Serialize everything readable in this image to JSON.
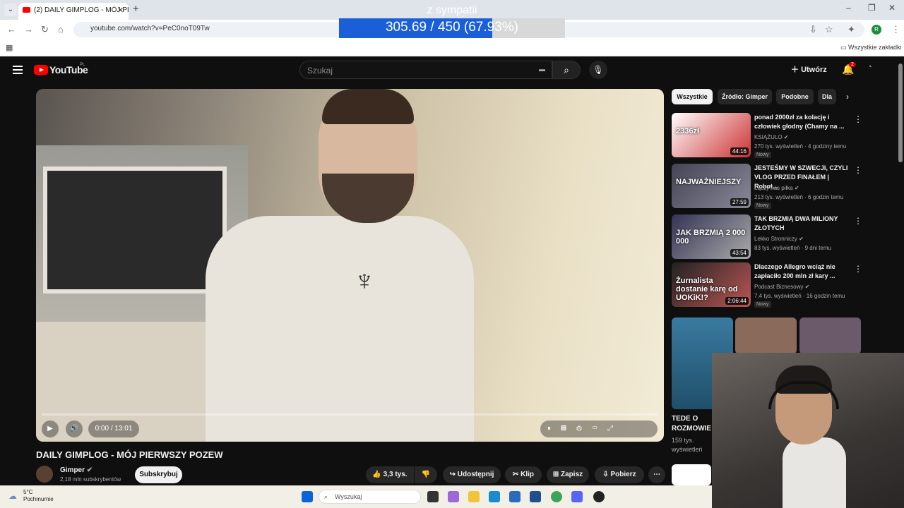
{
  "browser": {
    "tab_title": "(2) DAILY GIMPLOG - MÓJ PIERW...",
    "url": "youtube.com/watch?v=PeC0noT09Tw",
    "bookmarks_label": "Wszystkie zakładki"
  },
  "overlay": {
    "label": "z sympatii",
    "progress_text": "305.69 / 450 (67.93%)",
    "progress": 0.6793
  },
  "yt": {
    "logo": "YouTube",
    "region": "PL",
    "search_placeholder": "Szukaj",
    "create_label": "Utwórz",
    "notif_count": "2"
  },
  "video": {
    "time": "0:00 / 13:01",
    "title": "DAILY GIMPLOG - MÓJ PIERWSZY POZEW",
    "channel": "Gimper",
    "subscribers": "2,18 mln subskrybentów",
    "subscribe_label": "Subskrybuj",
    "likes": "3,3 tys.",
    "share": "Udostępnij",
    "clip": "Klip",
    "save": "Zapisz",
    "download": "Pobierz"
  },
  "chips": [
    "Wszystkie",
    "Źródło: Gimper",
    "Podobne",
    "Dla"
  ],
  "recs": [
    {
      "title": "ponad 2000zł za kolację i człowiek głodny (Chamy na ...",
      "channel": "KSIĄŻULO",
      "meta": "270 tys. wyświetleń · 4 godziny temu",
      "new": "Nowy",
      "duration": "44:16",
      "thumb_text": "2336zł"
    },
    {
      "title": "JESTEŚMY W SZWECJI, CZYLI VLOG PRZED FINAŁEM | Robot...",
      "channel": "Łączy nas piłka",
      "meta": "213 tys. wyświetleń · 6 godzin temu",
      "new": "Nowy",
      "duration": "27:59",
      "thumb_text": "NAJWAŻNIEJSZY"
    },
    {
      "title": "TAK BRZMIĄ DWA MILIONY ZŁOTYCH",
      "channel": "Lekko Stronniczy",
      "meta": "83 tys. wyświetleń · 9 dni temu",
      "new": "",
      "duration": "43:54",
      "thumb_text": "JAK BRZMIĄ 2 000 000"
    },
    {
      "title": "Dlaczego Allegro wciąż nie zapłaciło 200 mln zł kary ...",
      "channel": "Podcast Biznesowy",
      "meta": "7,4 tys. wyświetleń · 16 godzin temu",
      "new": "Nowy",
      "duration": "2:06:44",
      "thumb_text": "Żurnalista dostanie karę od UOKiK!?"
    }
  ],
  "shorts": {
    "title": "TEDE O ROZMOWIE",
    "views": "159 tys.",
    "views2": "wyświetleń"
  },
  "taskbar": {
    "temp": "5°C",
    "weather": "Pochmurnie",
    "search": "Wyszukaj"
  }
}
